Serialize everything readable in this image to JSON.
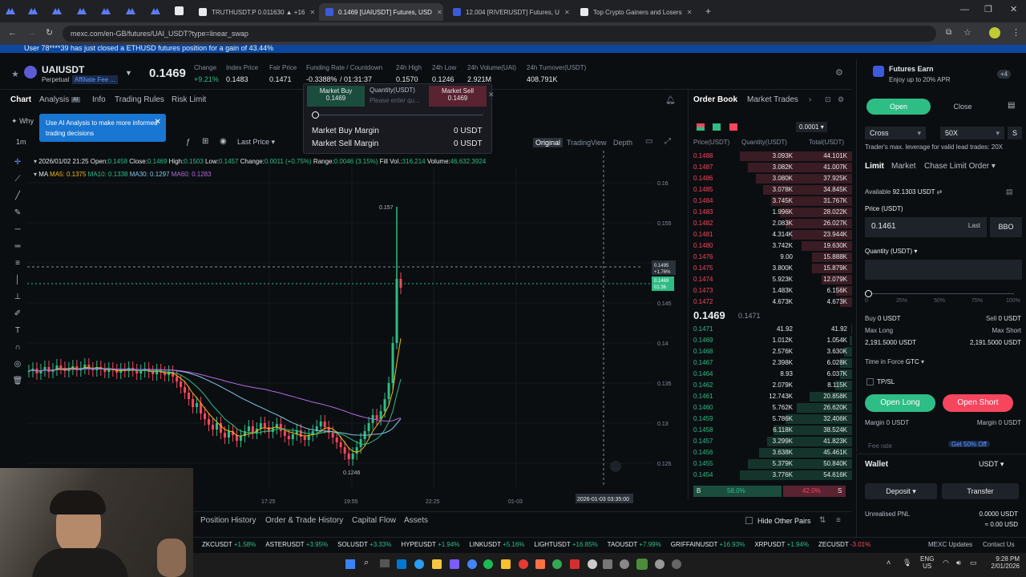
{
  "browser": {
    "tabs": [
      {
        "title": "TRUTHUSDT.P 0.011630 ▲ +16",
        "color": "#1e222d",
        "active": false
      },
      {
        "title": "0.1469 [UAIUSDT] Futures, USD",
        "color": "#3b5bdb",
        "active": true
      },
      {
        "title": "12.004 [RIVERUSDT] Futures, U",
        "color": "#3b5bdb",
        "active": false
      },
      {
        "title": "Top Crypto Gainers and Losers",
        "color": "#1e222d",
        "active": false
      }
    ],
    "url": "mexc.com/en-GB/futures/UAI_USDT?type=linear_swap"
  },
  "marquee": "User 78****39 has just closed a ETHUSD futures position for a gain of 43.44%",
  "header": {
    "symbol": "UAIUSDT",
    "perpetual": "Perpetual",
    "affiliate": "Affiliate Fee ...",
    "price": "0.1469",
    "change_label": "Change",
    "change_val": "+9.21%",
    "index_label": "Index Price",
    "index_val": "0.1483",
    "fair_label": "Fair Price",
    "fair_val": "0.1471",
    "funding_label": "Funding Rate / Countdown",
    "funding_val": "-0.3388%",
    "countdown": "/ 01:31:37",
    "high_label": "24h High",
    "high_val": "0.1570",
    "low_label": "24h Low",
    "low_val": "0.1246",
    "volume_label": "24h Volume(UAI)",
    "volume_val": "2.921M",
    "turnover_label": "24h Turnover(USDT)",
    "turnover_val": "408.791K"
  },
  "chart_tabs": {
    "chart": "Chart",
    "analysis": "Analysis",
    "ai": "AI",
    "info": "Info",
    "rules": "Trading Rules",
    "risk": "Risk Limit",
    "why": "Why"
  },
  "tooltip_ai": "Use AI Analysis to make more informed trading decisions",
  "chart_toolbar": {
    "interval": "1m",
    "last_price": "Last Price",
    "original": "Original",
    "tradingview": "TradingView",
    "depth": "Depth"
  },
  "market_popup": {
    "buy_label": "Market Buy",
    "buy_price": "0.1469",
    "qty_label": "Quantity(USDT)",
    "qty_placeholder": "Please enter qu...",
    "sell_label": "Market Sell",
    "sell_price": "0.1469",
    "buy_margin_label": "Market Buy Margin",
    "buy_margin_val": "0 USDT",
    "sell_margin_label": "Market Sell Margin",
    "sell_margin_val": "0 USDT"
  },
  "ohlc": {
    "date": "2026/01/02 21:25",
    "open_label": "Open:",
    "open": "0.1458",
    "close_label": "Close:",
    "close": "0.1469",
    "high_label": "High:",
    "high": "0.1503",
    "low_label": "Low:",
    "low": "0.1457",
    "change_label": "Change:",
    "change": "0.0011 (+0.75%)",
    "range_label": "Range:",
    "range": "0.0046 (3.15%)",
    "fill_label": "Fill Vol.:",
    "fill": "316,214",
    "volume_label": "Volume:",
    "volume": "46,632.3924"
  },
  "ma": {
    "ma_label": "MA",
    "ma5": "MA5: 0.1375",
    "ma10": "MA10: 0.1338",
    "ma30": "MA30: 0.1297",
    "ma60": "MA60: 0.1283"
  },
  "chart_data": {
    "type": "candlestick",
    "y_ticks": [
      "0.16",
      "0.155",
      "0.15",
      "0.145",
      "0.14",
      "0.135",
      "0.13",
      "0.125"
    ],
    "x_ticks": [
      "17:25",
      "19:55",
      "22:25",
      "01-03"
    ],
    "ylim": [
      0.122,
      0.162
    ],
    "high_marker": "0.157",
    "low_marker": "0.1246",
    "crosshair_price": "0.1495",
    "crosshair_pct": "+1.76%",
    "last_price_tag": "0.1469",
    "last_price_time": "01:36",
    "crosshair_time": "2026-01-03 03:35:00",
    "close_series": [
      0.1365,
      0.1368,
      0.1362,
      0.1366,
      0.137,
      0.1364,
      0.1367,
      0.1372,
      0.1369,
      0.1365,
      0.1368,
      0.1371,
      0.1366,
      0.1369,
      0.1373,
      0.1368,
      0.1366,
      0.137,
      0.1367,
      0.1364,
      0.1368,
      0.1366,
      0.1363,
      0.1367,
      0.1365,
      0.1369,
      0.1366,
      0.1362,
      0.1365,
      0.1368,
      0.1364,
      0.1361,
      0.1366,
      0.1363,
      0.136,
      0.1364,
      0.1358,
      0.1352,
      0.1345,
      0.1338,
      0.133,
      0.132,
      0.1325,
      0.1312,
      0.1305,
      0.1298,
      0.1292,
      0.13,
      0.1288,
      0.1282,
      0.129,
      0.1285,
      0.1278,
      0.1284,
      0.129,
      0.1296,
      0.1288,
      0.1293,
      0.13,
      0.1295,
      0.1289,
      0.1294,
      0.1299,
      0.129,
      0.1284,
      0.128,
      0.1286,
      0.1291,
      0.1283,
      0.1279,
      0.1285,
      0.129,
      0.1296,
      0.1302,
      0.1295,
      0.1288,
      0.1282,
      0.1276,
      0.127,
      0.1262,
      0.1255,
      0.1262,
      0.127,
      0.128,
      0.129,
      0.13,
      0.131,
      0.1305,
      0.1315,
      0.133,
      0.135,
      0.14,
      0.148,
      0.1469
    ]
  },
  "orderbook": {
    "tab_book": "Order Book",
    "tab_trades": "Market Trades",
    "precision": "0.0001",
    "col_price": "Price(USDT)",
    "col_qty": "Quantity(USDT)",
    "col_total": "Total(USDT)",
    "asks": [
      [
        "0.1488",
        "3.093K",
        "44.101K",
        1.0
      ],
      [
        "0.1487",
        "3.082K",
        "41.007K",
        0.93
      ],
      [
        "0.1486",
        "3.080K",
        "37.925K",
        0.86
      ],
      [
        "0.1485",
        "3.078K",
        "34.845K",
        0.79
      ],
      [
        "0.1484",
        "3.745K",
        "31.767K",
        0.72
      ],
      [
        "0.1483",
        "1.996K",
        "28.022K",
        0.64
      ],
      [
        "0.1482",
        "2.083K",
        "26.027K",
        0.59
      ],
      [
        "0.1481",
        "4.314K",
        "23.944K",
        0.54
      ],
      [
        "0.1480",
        "3.742K",
        "19.630K",
        0.45
      ],
      [
        "0.1476",
        "9.00",
        "15.888K",
        0.36
      ],
      [
        "0.1475",
        "3.800K",
        "15.879K",
        0.36
      ],
      [
        "0.1474",
        "5.923K",
        "12.079K",
        0.27
      ],
      [
        "0.1473",
        "1.483K",
        "6.156K",
        0.14
      ],
      [
        "0.1472",
        "4.673K",
        "4.673K",
        0.11
      ]
    ],
    "last": "0.1469",
    "mark": "0.1471",
    "bids": [
      [
        "0.1471",
        "41.92",
        "41.92",
        0.01
      ],
      [
        "0.1469",
        "1.012K",
        "1.054K",
        0.02
      ],
      [
        "0.1468",
        "2.576K",
        "3.630K",
        0.07
      ],
      [
        "0.1467",
        "2.398K",
        "6.028K",
        0.11
      ],
      [
        "0.1464",
        "8.93",
        "6.037K",
        0.11
      ],
      [
        "0.1462",
        "2.079K",
        "8.115K",
        0.15
      ],
      [
        "0.1461",
        "12.743K",
        "20.858K",
        0.38
      ],
      [
        "0.1460",
        "5.762K",
        "26.620K",
        0.49
      ],
      [
        "0.1459",
        "5.786K",
        "32.406K",
        0.59
      ],
      [
        "0.1458",
        "6.118K",
        "38.524K",
        0.7
      ],
      [
        "0.1457",
        "3.299K",
        "41.823K",
        0.76
      ],
      [
        "0.1456",
        "3.638K",
        "45.461K",
        0.83
      ],
      [
        "0.1455",
        "5.379K",
        "50.840K",
        0.93
      ],
      [
        "0.1454",
        "3.776K",
        "54.616K",
        1.0
      ]
    ],
    "buy_pct": "58.0%",
    "sell_pct": "42.0%",
    "b": "B",
    "s": "S"
  },
  "earn": {
    "title": "Futures Earn",
    "sub": "Enjoy up to 20% APR",
    "badge": "+4"
  },
  "trade": {
    "open": "Open",
    "close": "Close",
    "margin_mode": "Cross",
    "leverage": "50X",
    "s_btn": "S",
    "leverage_note": "Trader's max. leverage for valid lead trades: 20X",
    "type_limit": "Limit",
    "type_market": "Market",
    "type_chase": "Chase Limit Order",
    "available_label": "Available",
    "available_val": "92.1303 USDT",
    "price_label": "Price (USDT)",
    "price_val": "0.1461",
    "last": "Last",
    "bbo": "BBO",
    "qty_label": "Quantity (USDT)",
    "slider_ticks": [
      "0",
      "25%",
      "50%",
      "75%",
      "100%"
    ],
    "buy_label": "Buy",
    "buy_val": "0 USDT",
    "sell_label": "Sell",
    "sell_val": "0 USDT",
    "max_long": "Max Long",
    "max_short": "Max Short",
    "max_long_val": "2,191.5000 USDT",
    "max_short_val": "2,191.5000 USDT",
    "tif_label": "Time in Force",
    "tif_val": "GTC",
    "tpsl": "TP/SL",
    "open_long": "Open Long",
    "open_short": "Open Short",
    "margin_long": "Margin 0 USDT",
    "margin_short": "Margin 0 USDT",
    "fee": "Fee rate",
    "promo": "Get 50% Off"
  },
  "wallet": {
    "title": "Wallet",
    "currency": "USDT",
    "deposit": "Deposit",
    "transfer": "Transfer",
    "pnl_label": "Unrealised PNL",
    "pnl_val": "0.0000 USDT",
    "pnl_usd": "≈ 0.00 USD"
  },
  "bottom_tabs": [
    "Position History",
    "Order & Trade History",
    "Capital Flow",
    "Assets"
  ],
  "hide_other": "Hide Other Pairs",
  "coins": [
    [
      "ZKCUSDT",
      "+1.58%"
    ],
    [
      "ASTERUSDT",
      "+3.95%"
    ],
    [
      "SOLUSDT",
      "+3.33%"
    ],
    [
      "HYPEUSDT",
      "+1.94%"
    ],
    [
      "LINKUSDT",
      "+5.16%"
    ],
    [
      "LIGHTUSDT",
      "+16.85%"
    ],
    [
      "TAOUSDT",
      "+7.99%"
    ],
    [
      "GRIFFAINUSDT",
      "+16.93%"
    ],
    [
      "XRPUSDT",
      "+1.94%"
    ],
    [
      "ZECUSDT",
      "-3.01%"
    ]
  ],
  "footer_links": {
    "updates": "MEXC Updates",
    "contact": "Contact Us"
  },
  "taskbar": {
    "lang": "ENG",
    "region": "US",
    "time": "9:28 PM",
    "date": "2/01/2026"
  }
}
